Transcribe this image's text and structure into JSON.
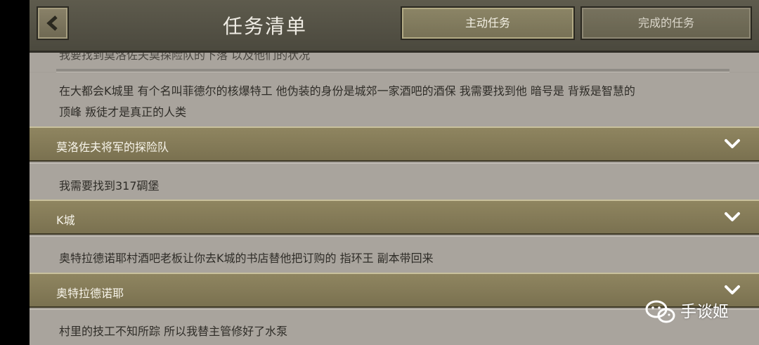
{
  "header": {
    "title": "任务清单",
    "back_icon": "chevron-left-icon",
    "tabs": [
      {
        "label": "主动任务",
        "active": true
      },
      {
        "label": "完成的任务",
        "active": false
      }
    ]
  },
  "list": {
    "partial_top_text": "我要找到莫洛佐夫莫探险队的下落 以及他们的状况",
    "first_description_line1": "在大都会K城里 有个名叫菲德尔的核爆特工 他伪装的身份是城郊一家酒吧的酒保 我需要找到他 暗号是 背叛是智慧的",
    "first_description_line2": "顶峰 叛徒才是真正的人类",
    "quests": [
      {
        "title": "莫洛佐夫将军的探险队",
        "description": "我需要找到317碉堡",
        "expand_icon": "chevron-down-icon"
      },
      {
        "title": "K城",
        "description": "奥特拉德诺耶村酒吧老板让你去K城的书店替他把订购的 指环王 副本带回来",
        "expand_icon": "chevron-down-icon"
      },
      {
        "title": "奥特拉德诺耶",
        "description": "村里的技工不知所踪 所以我替主管修好了水泵",
        "expand_icon": "chevron-down-icon"
      }
    ]
  },
  "watermark": {
    "icon": "wechat-icon",
    "text": "手谈姬"
  },
  "colors": {
    "header_bg": "#56533f",
    "quest_header_bg": "#857b58",
    "row_bg": "#a9a49d",
    "text_dark": "#2f2d28",
    "text_light": "#f7f4ea"
  }
}
